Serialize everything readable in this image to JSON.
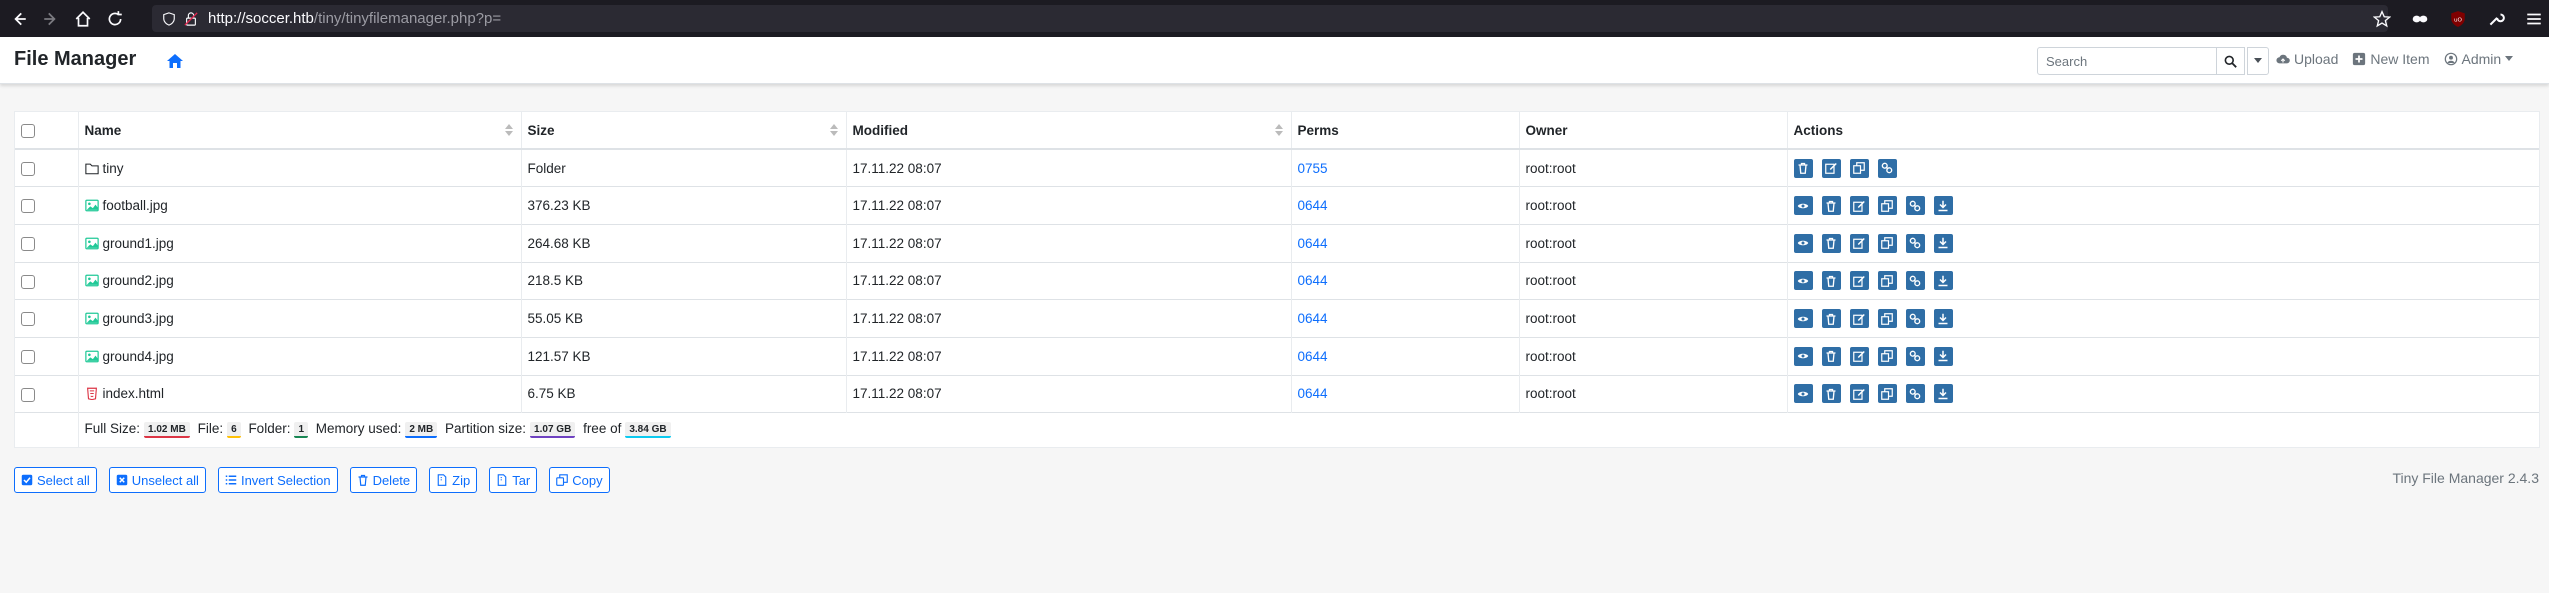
{
  "browser": {
    "url_host": "http://soccer.htb",
    "url_path": "/tiny/tinyfilemanager.php?p="
  },
  "navbar": {
    "brand": "File Manager",
    "search_placeholder": "Search",
    "upload_label": "Upload",
    "new_item_label": "New Item",
    "admin_label": "Admin"
  },
  "table": {
    "columns": [
      "Name",
      "Size",
      "Modified",
      "Perms",
      "Owner",
      "Actions"
    ],
    "rows": [
      {
        "name": "tiny",
        "size": "Folder",
        "modified": "17.11.22 08:07",
        "perms": "0755",
        "owner": "root:root",
        "type": "folder"
      },
      {
        "name": "football.jpg",
        "size": "376.23 KB",
        "modified": "17.11.22 08:07",
        "perms": "0644",
        "owner": "root:root",
        "type": "image"
      },
      {
        "name": "ground1.jpg",
        "size": "264.68 KB",
        "modified": "17.11.22 08:07",
        "perms": "0644",
        "owner": "root:root",
        "type": "image"
      },
      {
        "name": "ground2.jpg",
        "size": "218.5 KB",
        "modified": "17.11.22 08:07",
        "perms": "0644",
        "owner": "root:root",
        "type": "image"
      },
      {
        "name": "ground3.jpg",
        "size": "55.05 KB",
        "modified": "17.11.22 08:07",
        "perms": "0644",
        "owner": "root:root",
        "type": "image"
      },
      {
        "name": "ground4.jpg",
        "size": "121.57 KB",
        "modified": "17.11.22 08:07",
        "perms": "0644",
        "owner": "root:root",
        "type": "image"
      },
      {
        "name": "index.html",
        "size": "6.75 KB",
        "modified": "17.11.22 08:07",
        "perms": "0644",
        "owner": "root:root",
        "type": "html"
      }
    ]
  },
  "summary": {
    "full_size_label": "Full Size:",
    "full_size": "1.02 MB",
    "file_label": "File:",
    "file_count": "6",
    "folder_label": "Folder:",
    "folder_count": "1",
    "memory_label": "Memory used:",
    "memory": "2 MB",
    "partition_label": "Partition size:",
    "partition": "1.07 GB",
    "free_label": "free of",
    "free": "3.84 GB"
  },
  "buttons": {
    "select_all": "Select all",
    "unselect_all": "Unselect all",
    "invert": "Invert Selection",
    "delete": "Delete",
    "zip": "Zip",
    "tar": "Tar",
    "copy": "Copy"
  },
  "version": "Tiny File Manager 2.4.3",
  "colors": {
    "accent": "#0d6efd",
    "action_button": "#2f6ea6",
    "browser_bg": "#1c1b22"
  }
}
